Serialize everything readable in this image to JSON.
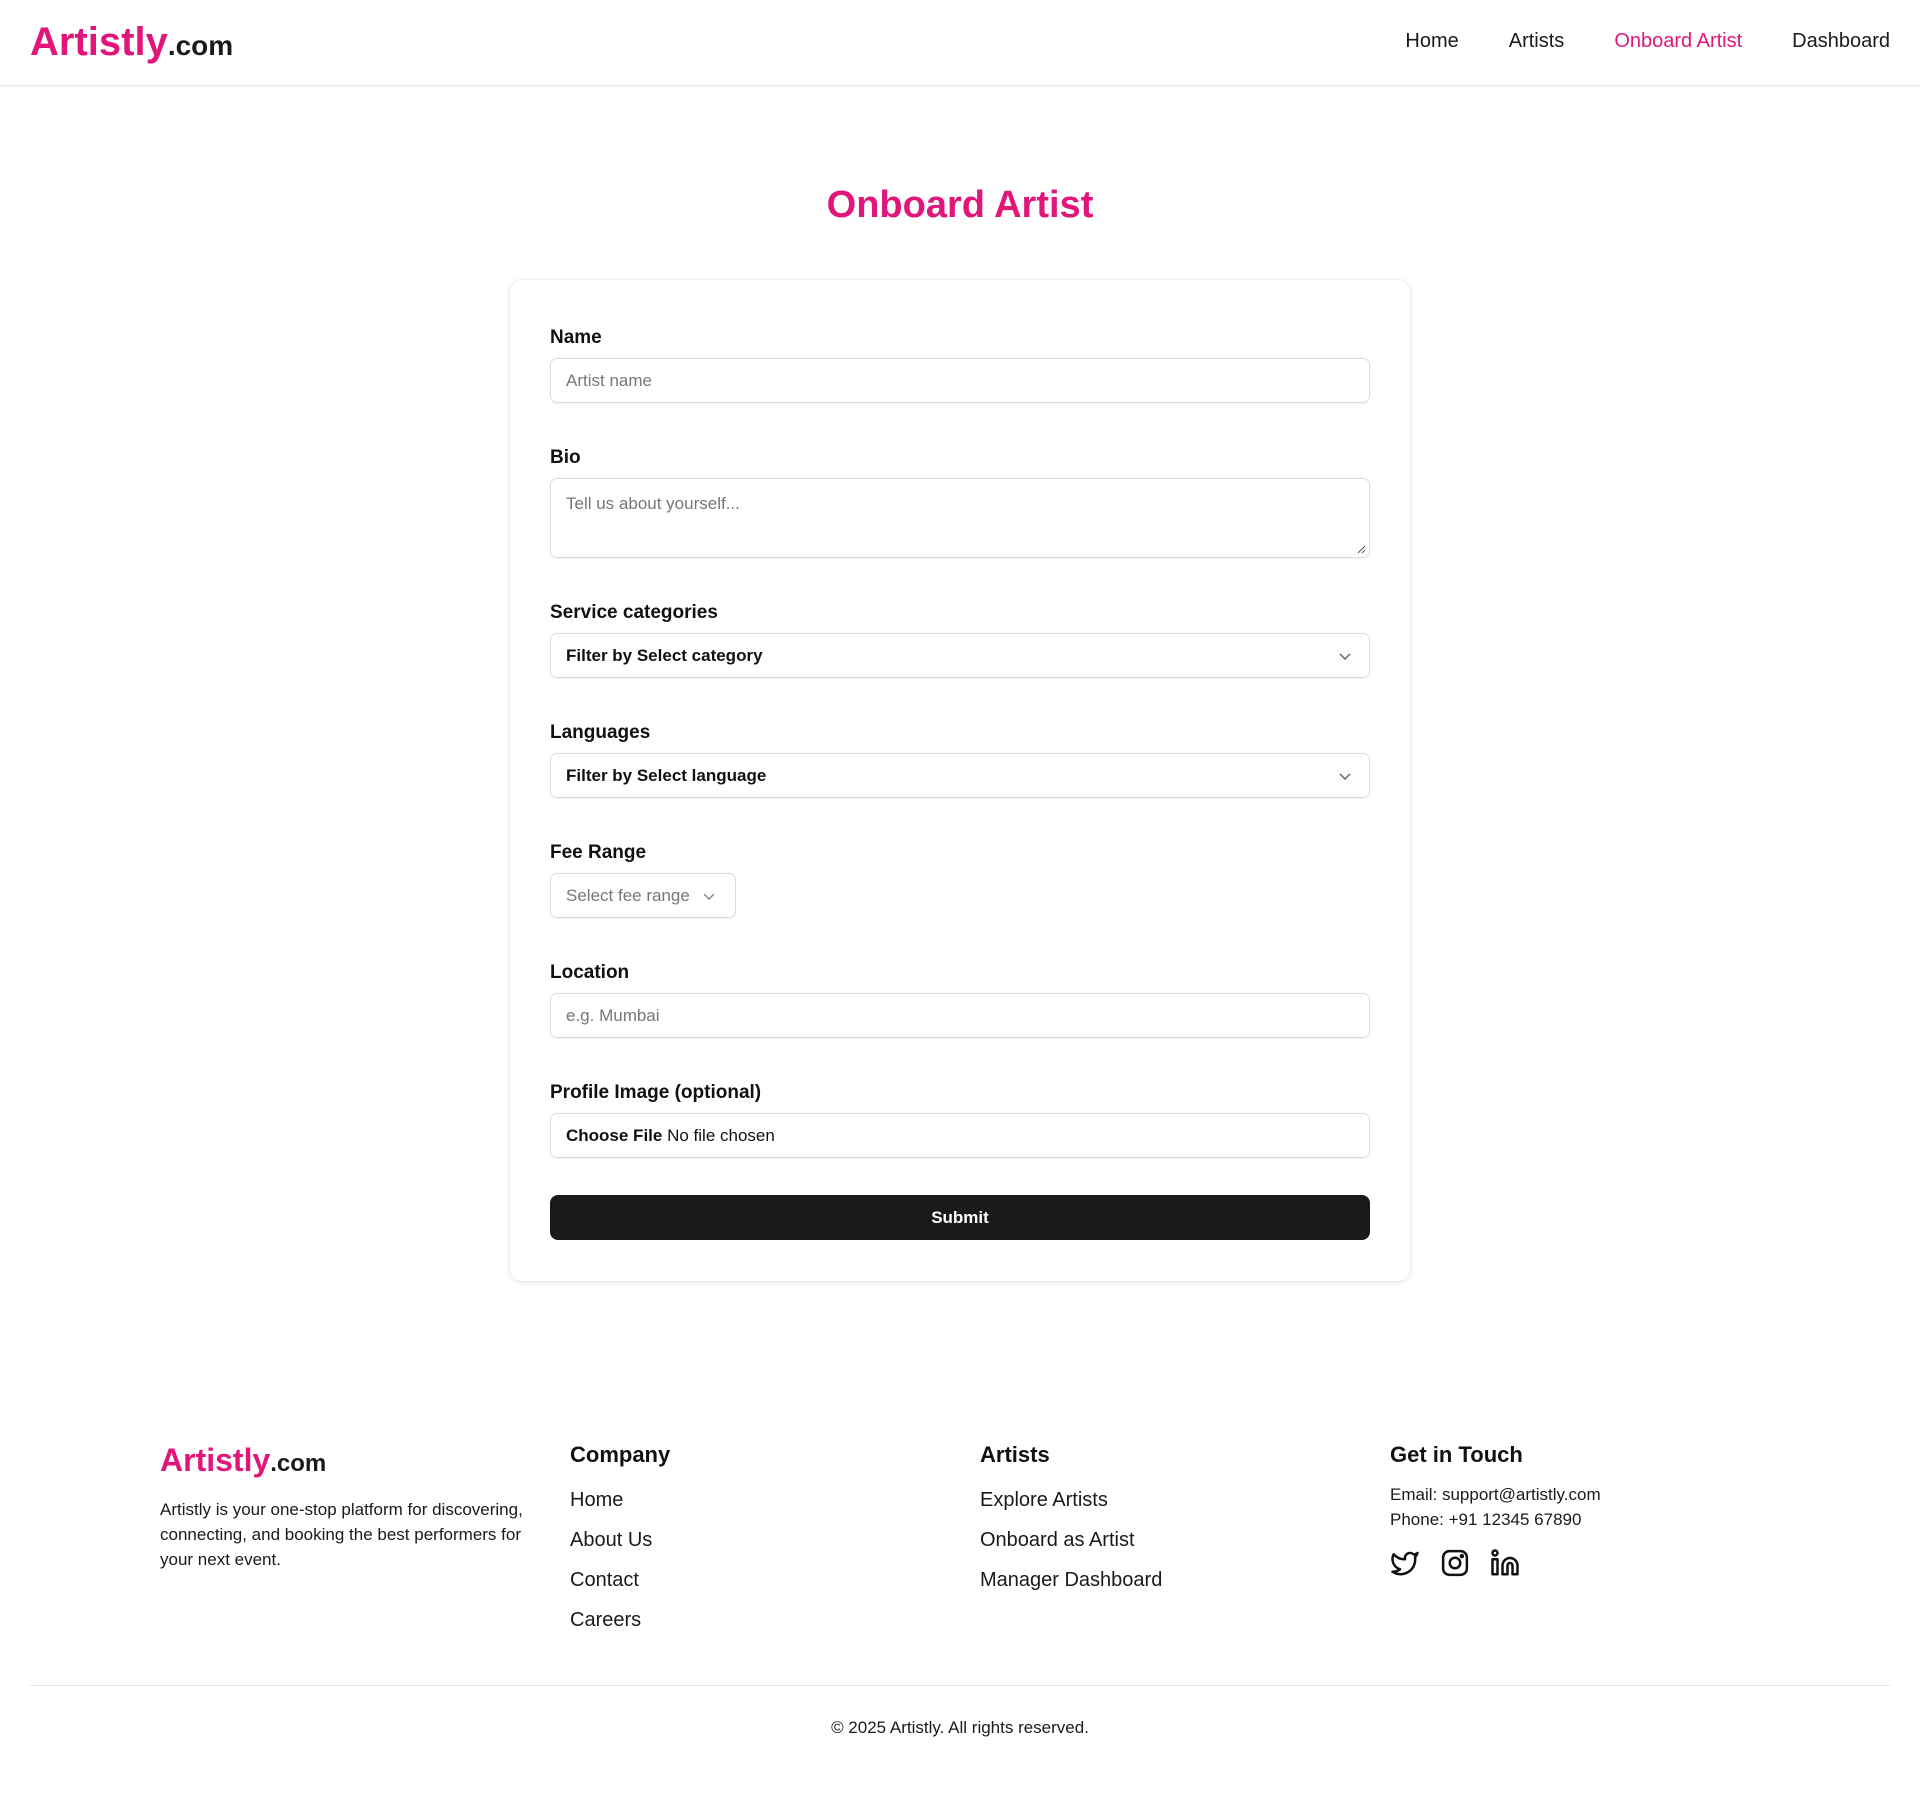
{
  "header": {
    "logo_brand": "Artistly",
    "logo_tld": ".com",
    "nav": [
      "Home",
      "Artists",
      "Onboard Artist",
      "Dashboard"
    ],
    "active_nav": "Onboard Artist"
  },
  "page": {
    "title": "Onboard Artist"
  },
  "form": {
    "name_label": "Name",
    "name_placeholder": "Artist name",
    "bio_label": "Bio",
    "bio_placeholder": "Tell us about yourself...",
    "categories_label": "Service categories",
    "categories_value": "Filter by Select category",
    "languages_label": "Languages",
    "languages_value": "Filter by Select language",
    "fee_label": "Fee Range",
    "fee_placeholder": "Select fee range",
    "location_label": "Location",
    "location_placeholder": "e.g. Mumbai",
    "image_label": "Profile Image (optional)",
    "file_button": "Choose File",
    "file_status": "No file chosen",
    "submit_label": "Submit"
  },
  "footer": {
    "logo_brand": "Artistly",
    "logo_tld": ".com",
    "description": "Artistly is your one-stop platform for discovering, connecting, and booking the best performers for your next event.",
    "company_heading": "Company",
    "company_links": [
      "Home",
      "About Us",
      "Contact",
      "Careers"
    ],
    "artists_heading": "Artists",
    "artists_links": [
      "Explore Artists",
      "Onboard as Artist",
      "Manager Dashboard"
    ],
    "contact_heading": "Get in Touch",
    "email": "Email: support@artistly.com",
    "phone": "Phone: +91 12345 67890",
    "social_icons": [
      "twitter-icon",
      "instagram-icon",
      "linkedin-icon"
    ],
    "copyright": "© 2025 Artistly. All rights reserved."
  },
  "colors": {
    "accent": "#e0167a",
    "text": "#1a1a1a",
    "button": "#1a1a1a"
  }
}
